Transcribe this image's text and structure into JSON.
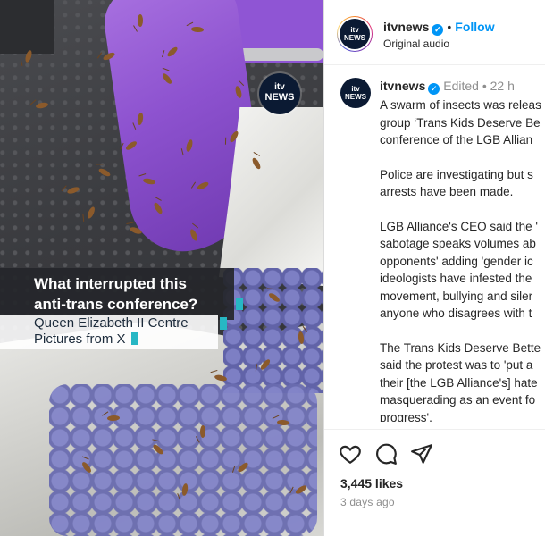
{
  "media": {
    "logo": {
      "line1": "itv",
      "line2": "NEWS"
    },
    "caption_title_line1": "What interrupted this",
    "caption_title_line2": "anti-trans conference?",
    "caption_sub_line1": "Queen Elizabeth II Centre",
    "caption_sub_line2": "Pictures from X",
    "accent_color": "#27b7c4"
  },
  "header": {
    "avatar": {
      "line1": "itv",
      "line2": "NEWS"
    },
    "username": "itvnews",
    "verified_icon": "verified-badge-icon",
    "separator": "•",
    "follow_label": "Follow",
    "audio_label": "Original audio"
  },
  "comment": {
    "avatar": {
      "line1": "itv",
      "line2": "NEWS"
    },
    "username": "itvnews",
    "edited": "Edited",
    "separator": "•",
    "time": "22 h",
    "paragraphs": [
      [
        "A swarm of insects was releas",
        "group ‘Trans Kids Deserve Be",
        "conference of the LGB Allian"
      ],
      [
        "Police are investigating but s",
        "arrests have been made."
      ],
      [
        "LGB Alliance's CEO said the '",
        "sabotage speaks volumes ab",
        "opponents' adding 'gender ic",
        "ideologists have infested the",
        "movement, bullying and siler",
        "anyone who disagrees with t"
      ],
      [
        "The Trans Kids Deserve Bette",
        "said the protest was to 'put a",
        "their [the LGB Alliance's] hate",
        "masquerading as an event fo",
        "progress'."
      ]
    ]
  },
  "actions": {
    "like_icon": "heart-icon",
    "comment_icon": "comment-bubble-icon",
    "share_icon": "paper-plane-icon",
    "likes": "3,445 likes",
    "posted": "3 days ago"
  },
  "colors": {
    "link_blue": "#0095f6",
    "verified_blue": "#0095f6",
    "itv_navy": "#0b1a33"
  }
}
